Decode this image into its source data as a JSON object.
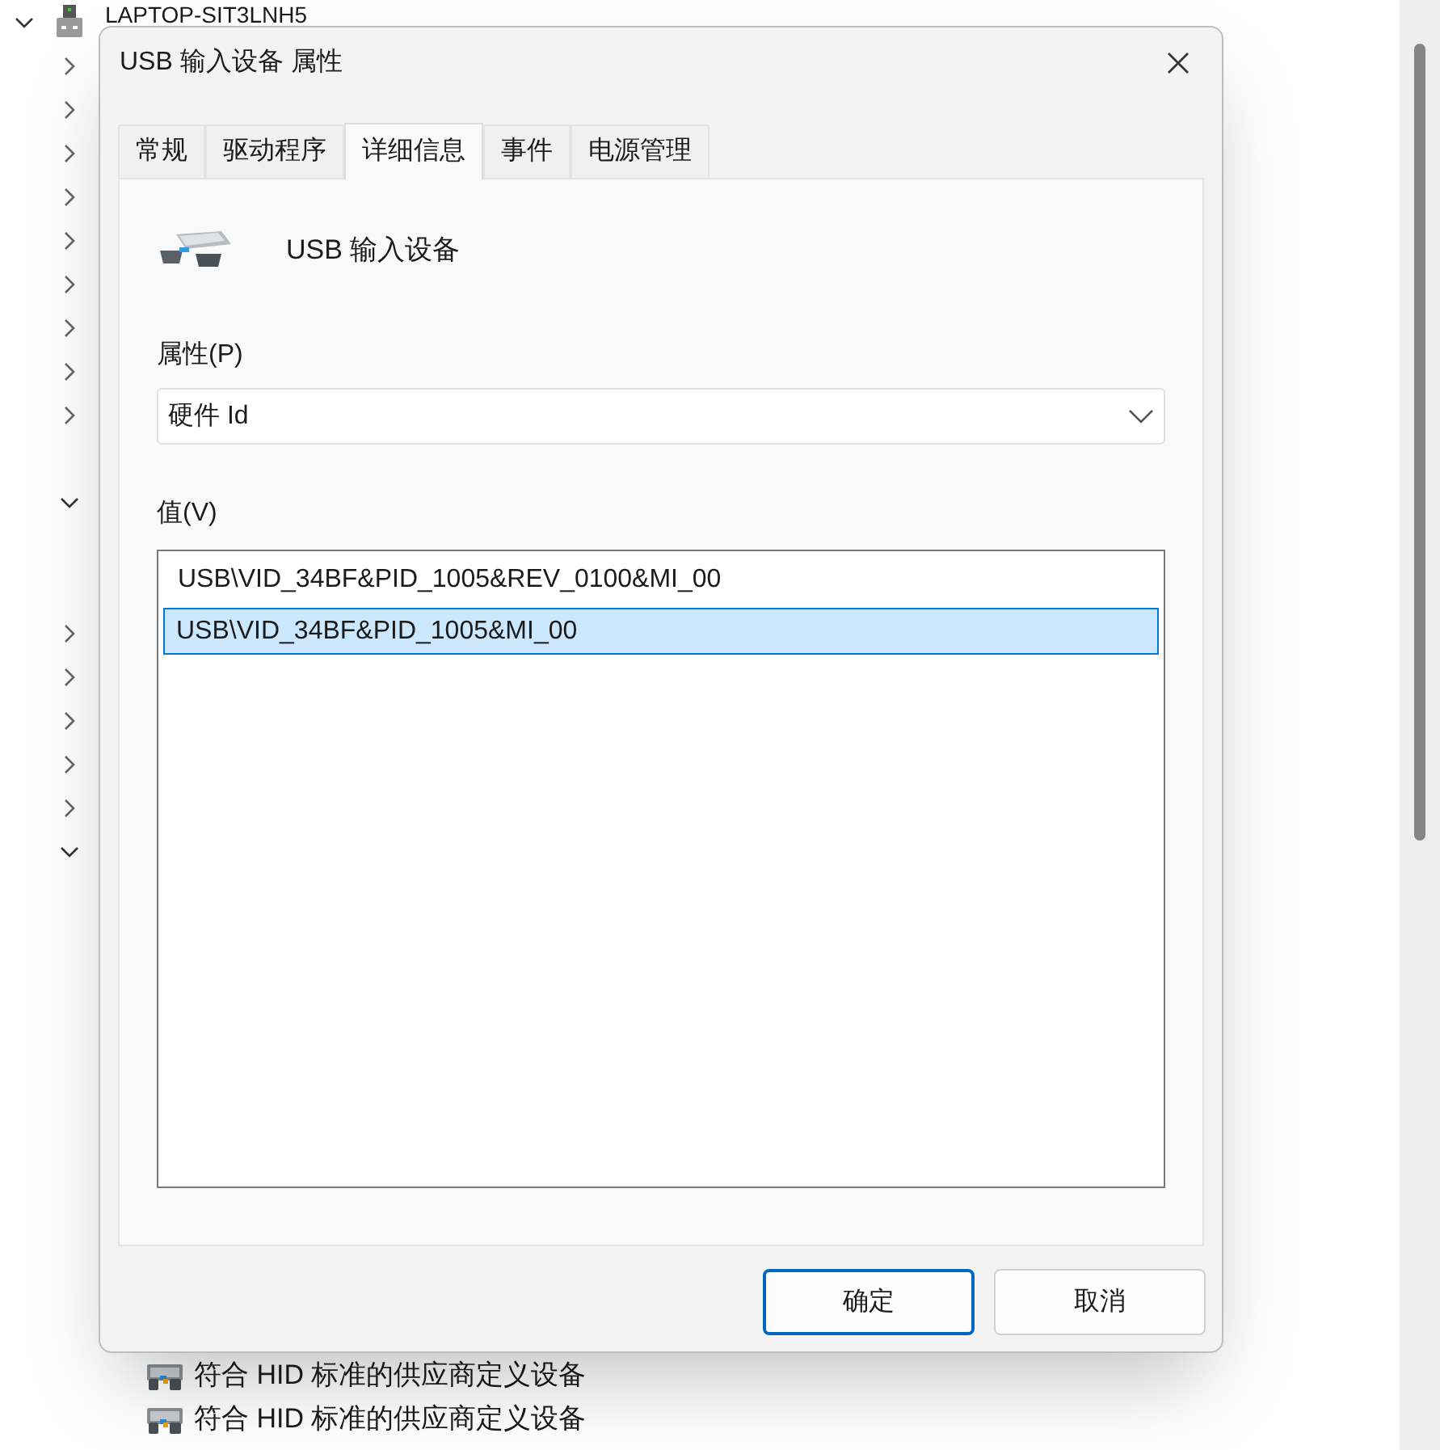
{
  "tree": {
    "root": {
      "label": "LAPTOP-SIT3LNH5",
      "expanded": true
    },
    "rows": [
      {
        "kind": "collapsed"
      },
      {
        "kind": "collapsed"
      },
      {
        "kind": "collapsed"
      },
      {
        "kind": "collapsed"
      },
      {
        "kind": "collapsed"
      },
      {
        "kind": "collapsed"
      },
      {
        "kind": "collapsed"
      },
      {
        "kind": "collapsed"
      },
      {
        "kind": "collapsed"
      },
      {
        "kind": "leaf"
      },
      {
        "kind": "expanded"
      },
      {
        "kind": "leaf"
      },
      {
        "kind": "leaf"
      },
      {
        "kind": "collapsed"
      },
      {
        "kind": "collapsed"
      },
      {
        "kind": "collapsed"
      },
      {
        "kind": "collapsed"
      },
      {
        "kind": "collapsed"
      },
      {
        "kind": "expanded"
      },
      {
        "kind": "leaf"
      },
      {
        "kind": "leaf"
      },
      {
        "kind": "leaf"
      },
      {
        "kind": "leaf"
      },
      {
        "kind": "leaf"
      },
      {
        "kind": "leaf"
      },
      {
        "kind": "leaf"
      },
      {
        "kind": "leaf"
      },
      {
        "kind": "leaf"
      },
      {
        "kind": "leaf"
      },
      {
        "kind": "leaf"
      },
      {
        "kind": "device",
        "label": "符合 HID 标准的供应商定义设备"
      },
      {
        "kind": "device",
        "label": "符合 HID 标准的供应商定义设备"
      }
    ]
  },
  "dialog": {
    "title": "USB 输入设备 属性",
    "tabs": [
      {
        "label": "常规",
        "selected": false
      },
      {
        "label": "驱动程序",
        "selected": false
      },
      {
        "label": "详细信息",
        "selected": true
      },
      {
        "label": "事件",
        "selected": false
      },
      {
        "label": "电源管理",
        "selected": false
      }
    ],
    "device_name": "USB 输入设备",
    "property_label": "属性(P)",
    "property_value": "硬件 Id",
    "value_label": "值(V)",
    "values": [
      {
        "text": "USB\\VID_34BF&PID_1005&REV_0100&MI_00",
        "selected": false
      },
      {
        "text": "USB\\VID_34BF&PID_1005&MI_00",
        "selected": true
      }
    ],
    "buttons": [
      {
        "label": "确定",
        "default": true
      },
      {
        "label": "取消",
        "default": false
      }
    ]
  }
}
